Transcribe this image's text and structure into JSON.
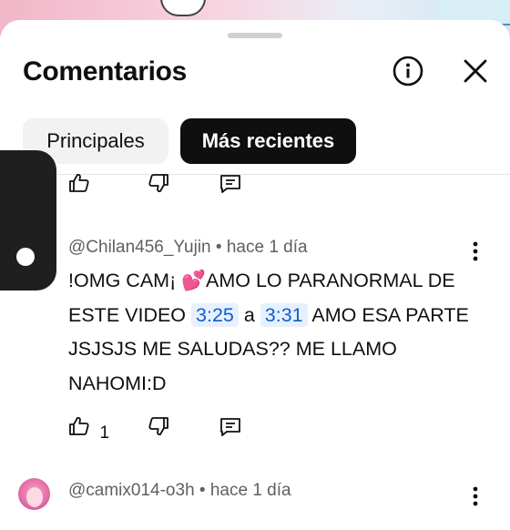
{
  "panel": {
    "title": "Comentarios",
    "info_icon": "info-icon",
    "close_icon": "close-icon"
  },
  "filters": [
    {
      "label": "Principales",
      "selected": false
    },
    {
      "label": "Más recientes",
      "selected": true
    }
  ],
  "comments": [
    {
      "author": "@Chilan456_Yujin",
      "time": "hace 1 día",
      "text_parts": {
        "t1": "!OMG CAM¡ ",
        "emoji": "💕",
        "t2": "AMO LO PARANORMAL DE ESTE VIDEO ",
        "ts1": "3:25",
        "t3": " a ",
        "ts2": "3:31",
        "t4": " AMO ESA PARTE JSJSJS ME SALUDAS?? ME LLAMO NAHOMI:D"
      },
      "likes": "1"
    },
    {
      "author": "@camix014-o3h",
      "time": "hace 1 día"
    }
  ],
  "separator": " • ",
  "colors": {
    "active_chip": "#0f0f0f",
    "timestamp_link": "#065fd4",
    "timestamp_bg": "#e8f0fe"
  }
}
